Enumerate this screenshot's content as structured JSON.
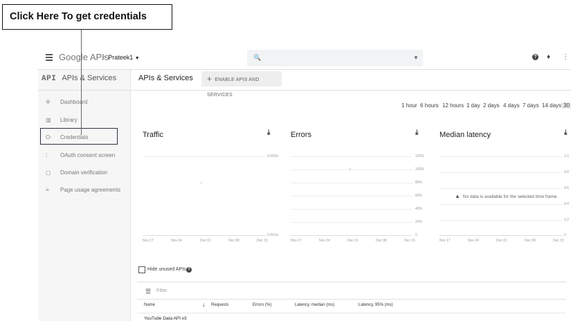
{
  "callout": {
    "text": "Click Here To get credentials"
  },
  "topbar": {
    "logo": "Google APIs",
    "project": "Prateek1",
    "search_placeholder": ""
  },
  "sidebar": {
    "title": "APIs & Services",
    "title_prefix": "API",
    "items": [
      {
        "label": "Dashboard",
        "icon": "dashboard-icon"
      },
      {
        "label": "Library",
        "icon": "library-icon"
      },
      {
        "label": "Credentials",
        "icon": "key-icon",
        "highlighted": true
      },
      {
        "label": "OAuth consent screen",
        "icon": "consent-icon"
      },
      {
        "label": "Domain verification",
        "icon": "domain-icon"
      },
      {
        "label": "Page usage agreements",
        "icon": "agreements-icon"
      }
    ]
  },
  "header": {
    "title": "APIs & Services",
    "enable_button": "ENABLE APIS AND SERVICES"
  },
  "time_range": {
    "options": [
      "1 hour",
      "6 hours",
      "12 hours",
      "1 day",
      "2 days",
      "4 days",
      "7 days",
      "14 days",
      "30"
    ],
    "selected": "30"
  },
  "charts": {
    "traffic": {
      "title": "Traffic",
      "y_top": "0.002/s",
      "y_bottom": "0.001/s",
      "x_labels": [
        "Nov 17",
        "Nov 24",
        "Dec 01",
        "Dec 08",
        "Dec 15"
      ]
    },
    "errors": {
      "title": "Errors",
      "y_labels": [
        "120%",
        "100%",
        "80%",
        "60%",
        "40%",
        "20%",
        "0"
      ],
      "x_labels": [
        "Nov 17",
        "Nov 24",
        "Dec 01",
        "Dec 08",
        "Dec 15"
      ]
    },
    "latency": {
      "title": "Median latency",
      "no_data": "No data is available for the selected time frame.",
      "y_labels": [
        "1.0",
        "0.8",
        "0.6",
        "0.4",
        "0.2",
        "0"
      ],
      "x_labels": [
        "Nov 17",
        "Nov 24",
        "Dec 01",
        "Dec 08",
        "Dec 15"
      ]
    }
  },
  "table": {
    "hide_unused_label": "Hide unused APIs",
    "filter_placeholder": "Filter",
    "columns": [
      "Name",
      "Requests",
      "Errors (%)",
      "Latency, median (ms)",
      "Latency, 95% (ms)"
    ],
    "rows": [
      {
        "name": "YouTube Data API v3"
      }
    ]
  },
  "colors": {
    "highlight_border": "#2c3340",
    "sidebar_bg": "#f6f6f6"
  }
}
